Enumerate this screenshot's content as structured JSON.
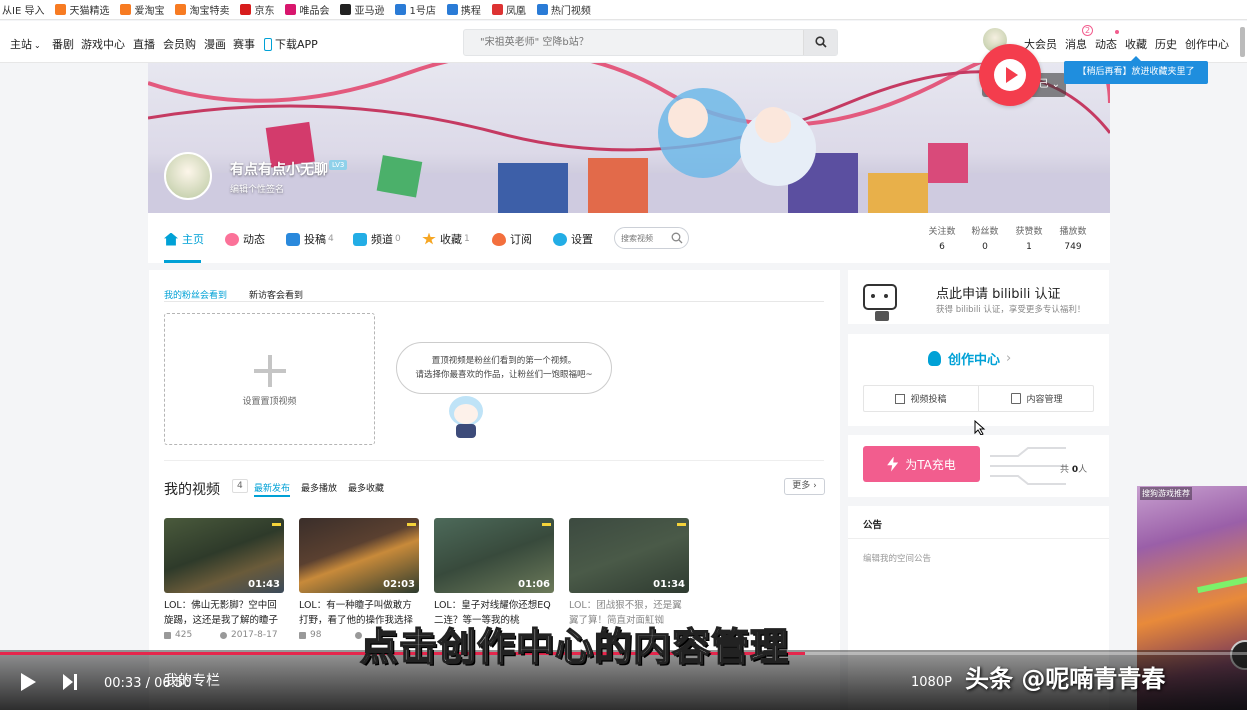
{
  "bookmarks": [
    {
      "label": "从IE 导入",
      "color": "#ffffff"
    },
    {
      "label": "天猫精选",
      "color": "#f77b22"
    },
    {
      "label": "爱淘宝",
      "color": "#f77b22"
    },
    {
      "label": "淘宝特卖",
      "color": "#f77b22"
    },
    {
      "label": "京东",
      "color": "#d71c1c"
    },
    {
      "label": "唯品会",
      "color": "#d8166d"
    },
    {
      "label": "亚马逊",
      "color": "#222222"
    },
    {
      "label": "1号店",
      "color": "#2a7bd6"
    },
    {
      "label": "携程",
      "color": "#2a7bd6"
    },
    {
      "label": "凤凰",
      "color": "#d33"
    },
    {
      "label": "热门视频",
      "color": "#2a7bd6"
    }
  ],
  "nav": {
    "left": [
      "主站",
      "番剧",
      "游戏中心",
      "直播",
      "会员购",
      "漫画",
      "赛事",
      "下载APP"
    ],
    "search_placeholder": "\"宋祖英老师\" 空降b站？",
    "right": [
      "大会员",
      "消息",
      "动态",
      "收藏",
      "历史",
      "创作中心"
    ],
    "msg_badge": "2",
    "watch_later_tip": "【稍后再看】放进收藏夹里了",
    "partial_button": "己"
  },
  "profile": {
    "name": "有点有点小无聊",
    "level": "LV3",
    "signature": "编辑个性签名"
  },
  "tabs": [
    {
      "label": "主页",
      "count": "",
      "color": "#00a1d6"
    },
    {
      "label": "动态",
      "count": "",
      "color": "#fb7299"
    },
    {
      "label": "投稿",
      "count": "4",
      "color": "#2a89dc"
    },
    {
      "label": "频道",
      "count": "0",
      "color": "#23ade5"
    },
    {
      "label": "收藏",
      "count": "1",
      "color": "#f6a623"
    },
    {
      "label": "订阅",
      "count": "",
      "color": "#f36f3d"
    },
    {
      "label": "设置",
      "count": "",
      "color": "#23ade5"
    }
  ],
  "tab_search_placeholder": "搜索视频",
  "stats": [
    {
      "label": "关注数",
      "value": "6"
    },
    {
      "label": "粉丝数",
      "value": "0"
    },
    {
      "label": "获赞数",
      "value": "1"
    },
    {
      "label": "播放数",
      "value": "749"
    }
  ],
  "main": {
    "subtabs": [
      "我的粉丝会看到",
      "新访客会看到"
    ],
    "set_top_label": "设置置顶视频",
    "bubble_line1": "置顶视频是粉丝们看到的第一个视频。",
    "bubble_line2": "请选择你最喜欢的作品，让粉丝们一饱眼福吧~",
    "my_videos_title": "我的视频",
    "my_videos_count": "4",
    "sort": [
      "最新发布",
      "最多播放",
      "最多收藏"
    ],
    "more": "更多",
    "column_title": "我的专栏"
  },
  "videos": [
    {
      "title": "LOL：佛山无影脚？空中回旋踢，这还是我了解的矎子吗？",
      "duration": "01:43",
      "views": "425",
      "date": "2017-8-17"
    },
    {
      "title": "LOL：有一种矎子叫做敢方打野，看了他的操作我选择平个",
      "duration": "02:03",
      "views": "98",
      "date": ""
    },
    {
      "title": "LOL：皇子对线耀你还想EQ二连？等一等我的桃",
      "duration": "01:06",
      "views": "",
      "date": ""
    },
    {
      "title": "LOL：团战狠不狠，还是翼翼了算！简直对面魟铷",
      "duration": "01:34",
      "views": "",
      "date": ""
    }
  ],
  "side": {
    "auth_title": "点此申请 bilibili 认证",
    "auth_sub": "获得 bilibili 认证，享受更多专认福利！",
    "creation_title": "创作中心",
    "btn_upload": "视频投稿",
    "btn_manage": "内容管理",
    "charge_btn": "为TA充电",
    "charge_total_prefix": "共",
    "charge_total_value": "0",
    "charge_total_suffix": "人",
    "notice_title": "公告",
    "notice_edit": "编辑我的空间公告",
    "popup_title": "搜狗游戏推荐"
  },
  "player": {
    "time_current": "00:33",
    "time_total": "06:50",
    "quality": "1080P",
    "progress": 0.0805,
    "subtitle": "点击创作中心的内容管理",
    "watermark": "头条 @呢喃青青春"
  },
  "colors": {
    "accent": "#00a1d6",
    "pink": "#fb7299",
    "charge": "#f25d8e",
    "player_red": "#e5264c"
  }
}
